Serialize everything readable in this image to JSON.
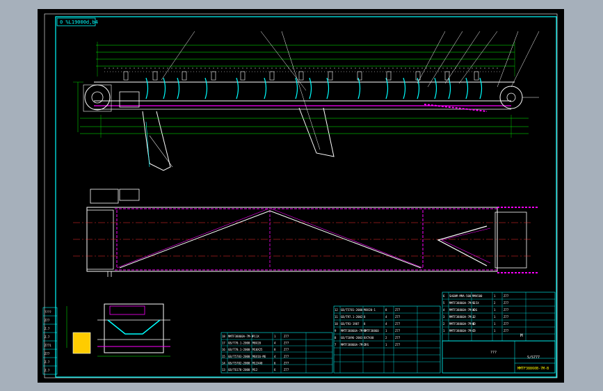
{
  "drawing": {
    "stamp": "0 %L19000d,b4",
    "title_block": {
      "company": "???",
      "drawing_no": "MMTF38860B-7M-B",
      "scale_label": "S/S777",
      "material_hint": "M"
    }
  },
  "bom_rows": [
    {
      "no": "18",
      "code": "MMTF38860A-7M-X",
      "name": "P11X",
      "qty": "1",
      "mat": "Z77"
    },
    {
      "no": "17",
      "code": "GB/T70.1-2000",
      "name": "M8X20",
      "qty": "4",
      "mat": "Z77"
    },
    {
      "no": "16",
      "code": "GB/T70.1-2000",
      "name": "M10X25",
      "qty": "8",
      "mat": "Z77"
    },
    {
      "no": "15",
      "code": "GB/T5783-2000",
      "name": "M6X16-M6",
      "qty": "4",
      "mat": "Z77"
    },
    {
      "no": "14",
      "code": "GB/T5782-2000",
      "name": "M12X40",
      "qty": "6",
      "mat": "Z77"
    },
    {
      "no": "13",
      "code": "GB/T6170-2000",
      "name": "M12",
      "qty": "6",
      "mat": "Z77"
    }
  ],
  "bom_rows_mid": [
    {
      "no": "12",
      "code": "GB/T5781-2000",
      "name": "M8X20-1",
      "qty": "8",
      "mat": "Z77"
    },
    {
      "no": "11",
      "code": "GB/T97.1-2002",
      "name": "8",
      "qty": "4",
      "mat": "Z77"
    },
    {
      "no": "10",
      "code": "GB/T93-1987",
      "name": "8",
      "qty": "4",
      "mat": "Z77"
    },
    {
      "no": "9",
      "code": "MMTF38860A-7M-2",
      "name": "MMTF38860",
      "qty": "1",
      "mat": "Z77"
    },
    {
      "no": "8",
      "code": "GB/T1096-2003",
      "name": "8X7X40",
      "qty": "2",
      "mat": "Z77"
    },
    {
      "no": "7",
      "code": "MMTF38860A-7M-3",
      "name": "ZYG",
      "qty": "1",
      "mat": "Z77"
    }
  ],
  "bom_rows_right": [
    {
      "no": "6",
      "code": "SHGNM-MMA-500",
      "name": "MMA500",
      "qty": "1",
      "mat": "Z77"
    },
    {
      "no": "5",
      "code": "MMTF38860A-7M-5",
      "name": "S15X",
      "qty": "2",
      "mat": "Z77"
    },
    {
      "no": "4",
      "code": "MMTF38860A-7M-4",
      "name": "XDG",
      "qty": "1",
      "mat": "Z77"
    },
    {
      "no": "3",
      "code": "MMTF38860A-7M-1",
      "name": "JJ",
      "qty": "1",
      "mat": "Z77"
    },
    {
      "no": "2",
      "code": "MMTF38860A-7M-6",
      "name": "QD",
      "qty": "1",
      "mat": "Z77"
    },
    {
      "no": "1",
      "code": "MMTF38860A-7M-7",
      "name": "CD",
      "qty": "1",
      "mat": "Z77"
    }
  ],
  "left_strip": [
    "????",
    "Z77",
    "Z.7",
    "Z.7",
    "Z771",
    "Z77",
    "Z.7",
    "Z.7"
  ]
}
